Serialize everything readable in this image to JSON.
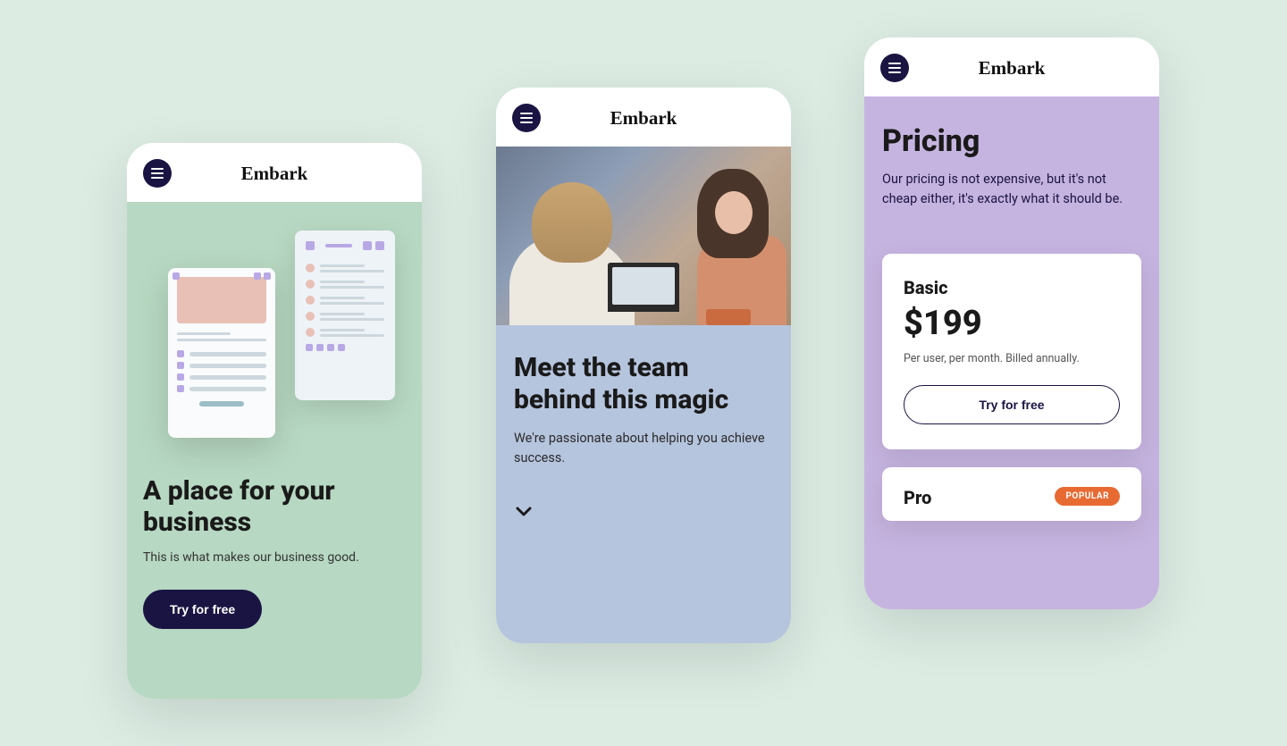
{
  "brand": "Embark",
  "phone1": {
    "heading": "A place for your business",
    "subtitle": "This is what makes our business good.",
    "cta": "Try for free"
  },
  "phone2": {
    "heading": "Meet the team behind this magic",
    "subtitle": "We're passionate about helping you achieve success."
  },
  "phone3": {
    "heading": "Pricing",
    "subtitle": "Our pricing is not expensive, but it's not cheap either, it's exactly what it should be.",
    "plans": [
      {
        "name": "Basic",
        "price": "$199",
        "sub": "Per user, per month. Billed annually.",
        "cta": "Try for free"
      },
      {
        "name": "Pro",
        "badge": "POPULAR"
      }
    ]
  }
}
